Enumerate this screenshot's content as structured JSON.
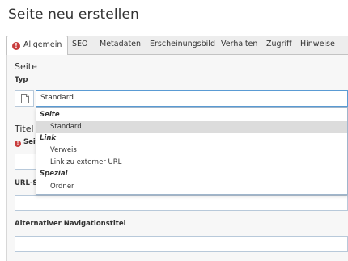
{
  "page": {
    "title": "Seite neu erstellen"
  },
  "tabs": [
    {
      "label": "Allgemein",
      "active": true,
      "has_error": true,
      "error_icon": "exclamation-circle-icon"
    },
    {
      "label": "SEO",
      "active": false
    },
    {
      "label": "Metadaten",
      "active": false
    },
    {
      "label": "Erscheinungsbild",
      "active": false
    },
    {
      "label": "Verhalten",
      "active": false
    },
    {
      "label": "Zugriff",
      "active": false
    },
    {
      "label": "Hinweise",
      "active": false
    }
  ],
  "sections": {
    "seite": {
      "title": "Seite"
    },
    "titel": {
      "title": "Titel"
    }
  },
  "fields": {
    "typ": {
      "label": "Typ",
      "value": "Standard",
      "icon": "page-icon"
    },
    "seitentitel": {
      "label": "Seit",
      "value": ""
    },
    "url_segment": {
      "label": "URL-S",
      "value": ""
    },
    "nav_title": {
      "label": "Alternativer Navigationstitel",
      "value": ""
    }
  },
  "dropdown": {
    "groups": [
      {
        "label": "Seite",
        "items": [
          {
            "label": "Standard",
            "selected": true
          }
        ]
      },
      {
        "label": "Link",
        "items": [
          {
            "label": "Verweis"
          },
          {
            "label": "Link zu externer URL"
          }
        ]
      },
      {
        "label": "Spezial",
        "items": [
          {
            "label": "Ordner"
          }
        ]
      }
    ]
  },
  "colors": {
    "error": "#c83c3c",
    "focus_border": "#5a9bd4",
    "selected_item_bg": "#dcdcdc",
    "tabbar_bg": "#ededed",
    "panel_bg": "#f7f7f7"
  }
}
